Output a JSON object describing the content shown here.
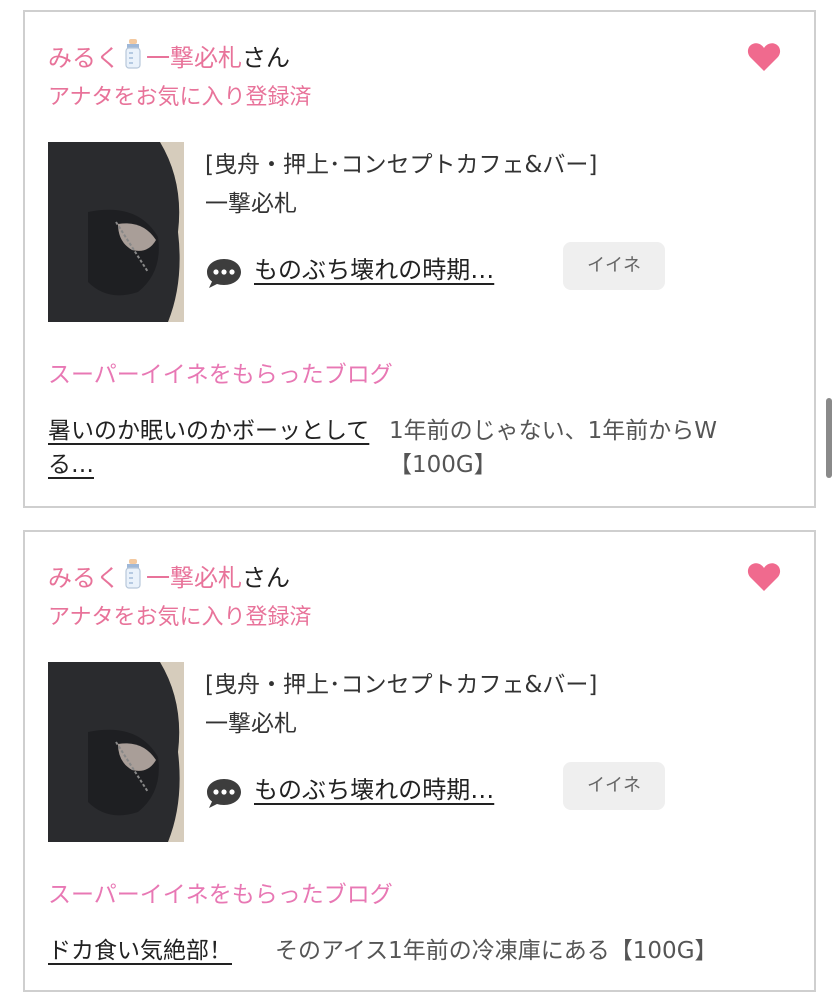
{
  "colors": {
    "accent_pink": "#e8739a",
    "section_pink": "#e878b4",
    "heart": "#f06a8e",
    "border": "#cfcfcf",
    "iine_bg": "#efefef"
  },
  "cards": [
    {
      "user": {
        "name": "みるく",
        "name2": "一撃必札",
        "suffix": "さん",
        "emoji_icon": "baby-bottle-icon"
      },
      "favorite_status": "アナタをお気に入り登録済",
      "heart_icon": "heart-icon",
      "shop_area": "[曳舟・押上･コンセプトカフェ&バー]",
      "shop_name": "一撃必札",
      "latest_post": "ものぶち壊れの時期…",
      "like_button": "イイネ",
      "section_title": "スーパーイイネをもらったブログ",
      "blog_title": "暑いのか眠いのかボーッとしてる…",
      "blog_excerpt": "1年前のじゃない、1年前からW【100G】"
    },
    {
      "user": {
        "name": "みるく",
        "name2": "一撃必札",
        "suffix": "さん",
        "emoji_icon": "baby-bottle-icon"
      },
      "favorite_status": "アナタをお気に入り登録済",
      "heart_icon": "heart-icon",
      "shop_area": "[曳舟・押上･コンセプトカフェ&バー]",
      "shop_name": "一撃必札",
      "latest_post": "ものぶち壊れの時期…",
      "like_button": "イイネ",
      "section_title": "スーパーイイネをもらったブログ",
      "blog_title": "ドカ食い気絶部！",
      "blog_excerpt": "そのアイス1年前の冷凍庫にある【100G】"
    }
  ]
}
